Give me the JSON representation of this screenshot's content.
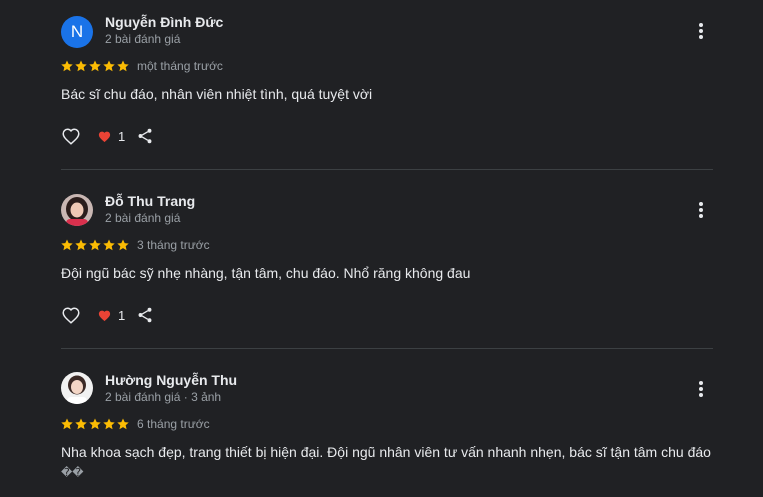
{
  "reviews": [
    {
      "name": "Nguyễn Đình Đức",
      "avatar_letter": "N",
      "meta": "2 bài đánh giá",
      "rating": 5,
      "date": "một tháng trước",
      "text": "Bác sĩ chu đáo, nhân viên nhiệt tình, quá tuyệt vời",
      "reaction_count": "1"
    },
    {
      "name": "Đỗ Thu Trang",
      "meta": "2 bài đánh giá",
      "rating": 5,
      "date": "3 tháng trước",
      "text": "Đội ngũ bác sỹ nhẹ nhàng, tận tâm, chu đáo. Nhổ răng không đau",
      "reaction_count": "1"
    },
    {
      "name": "Hường Nguyễn Thu",
      "meta": "2 bài đánh giá · 3 ảnh",
      "rating": 5,
      "date": "6 tháng trước",
      "text": "Nha khoa sạch đẹp, trang thiết bị hiện đại. Đội ngũ nhân viên tư vấn nhanh nhẹn, bác sĩ tận tâm chu đáo",
      "text_line2": "��"
    }
  ],
  "colors": {
    "background": "#202124",
    "star": "#fbbc04",
    "heart": "#ea4335",
    "avatar_n": "#1a73e8",
    "divider": "#3c4043"
  },
  "icons": {
    "more": "more-vert-icon",
    "like": "heart-outline-icon",
    "reaction": "heart-filled-icon",
    "share": "share-icon",
    "star": "star-icon"
  }
}
